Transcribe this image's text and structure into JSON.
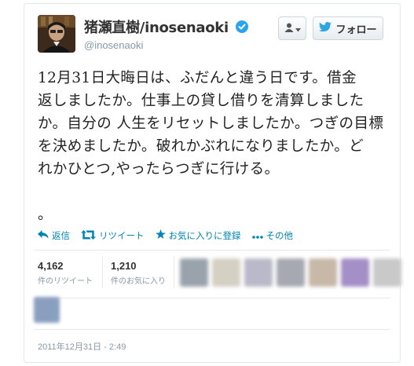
{
  "profile": {
    "name": "猪瀬直樹/inosenaoki",
    "screen_name": "@inosenaoki"
  },
  "buttons": {
    "follow_label": "フォロー"
  },
  "tweet": {
    "text": "12月31日大晦日は、ふだんと違う日です。借金\n返しましたか。仕事上の貸し借りを清算しました\nか。自分の 人生をリセットしましたか。つぎの目標\nを決めましたか。破れかぶれになりましたか。ど\nれかひとつ,やったらつぎに行ける。\n\n。"
  },
  "actions": {
    "reply": "返信",
    "retweet": "リツイート",
    "favorite": "お気に入りに登録",
    "more": "その他"
  },
  "stats": {
    "retweets_count": "4,162",
    "retweets_label": "件のリツイート",
    "favorites_count": "1,210",
    "favorites_label": "件のお気に入り"
  },
  "timestamp": "2011年12月31日 - 2:49",
  "colors": {
    "link": "#0084b4",
    "twitter_blue": "#2ba6e1",
    "verified": "#2aa3ef",
    "muted": "#8899a6"
  },
  "icons": [
    "user-icon",
    "caret-down-icon",
    "twitter-bird-icon",
    "verified-icon",
    "reply-icon",
    "retweet-icon",
    "star-icon",
    "more-dots-icon"
  ]
}
